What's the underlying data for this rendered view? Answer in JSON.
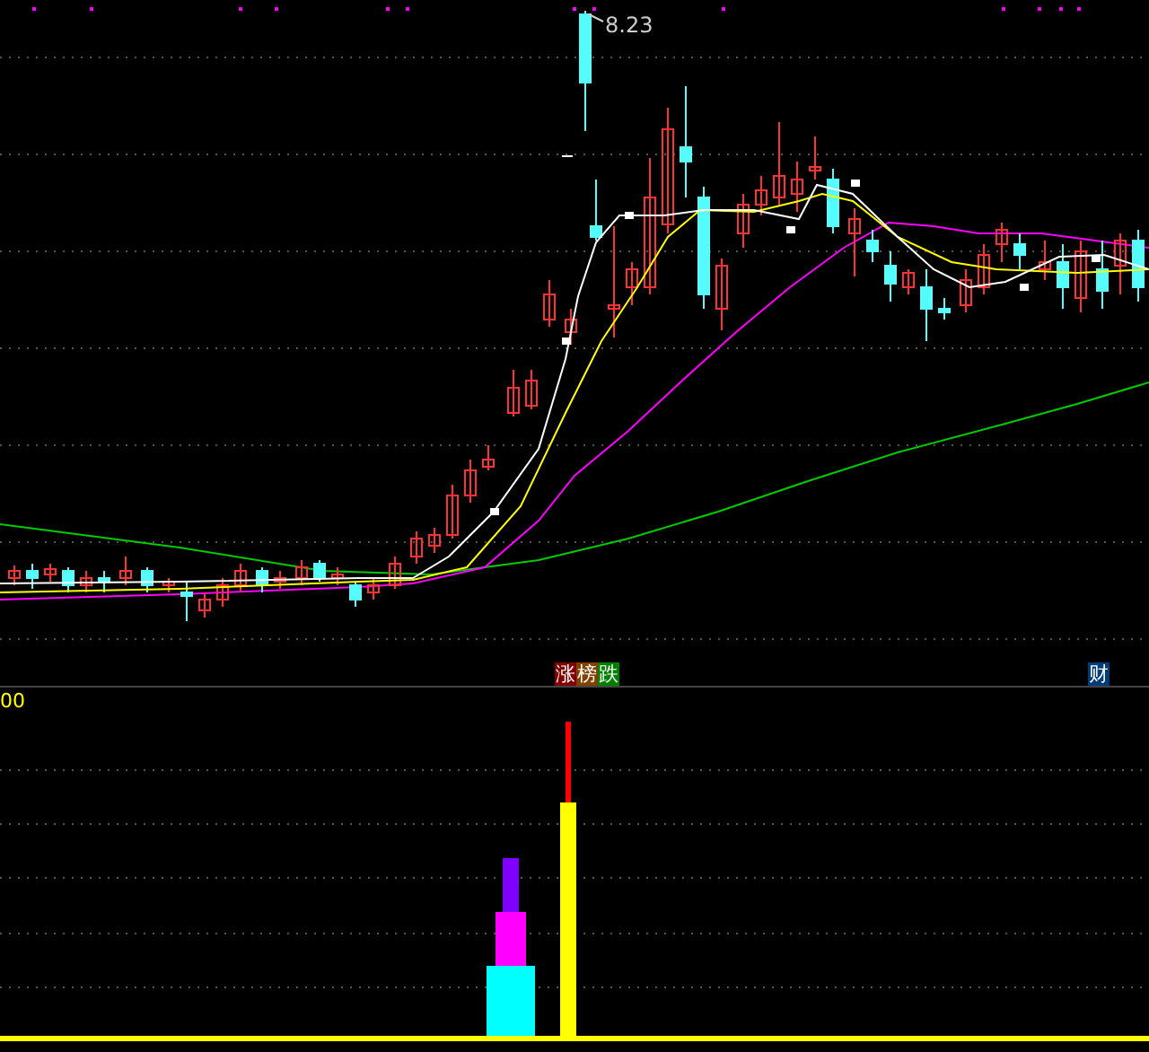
{
  "price_chart": {
    "high_label": "8.23"
  },
  "signal_tags": [
    {
      "text": "涨",
      "color": "#800000"
    },
    {
      "text": "榜",
      "color": "#804000"
    },
    {
      "text": "跌",
      "color": "#008000"
    }
  ],
  "finance_tag": {
    "text": "财",
    "color": "#003c78"
  },
  "indicator_panel": {
    "axis_label": "00"
  }
}
